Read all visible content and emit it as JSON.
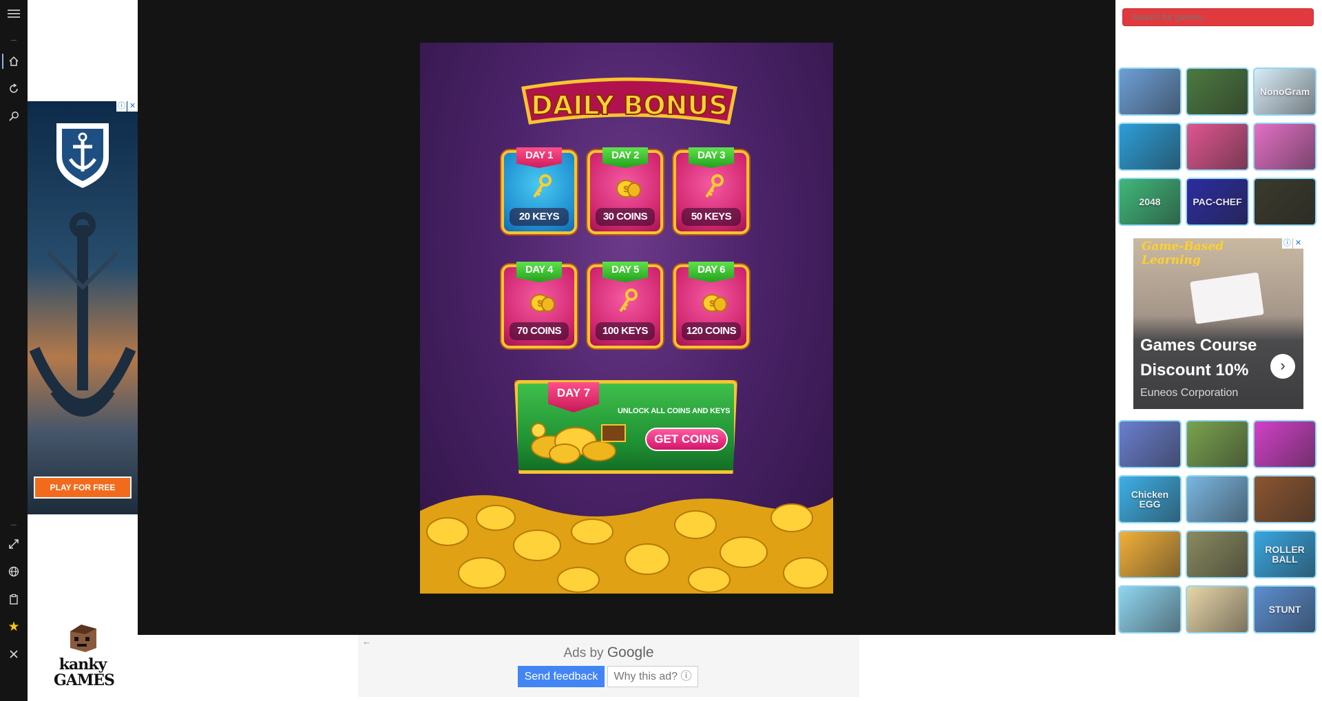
{
  "rail": {
    "icons": [
      "menu-icon",
      "home-icon",
      "refresh-icon",
      "search-icon",
      "fullscreen-icon",
      "globe-icon",
      "clipboard-icon",
      "star-icon",
      "close-icon"
    ]
  },
  "left_ad": {
    "cta": "PLAY FOR FREE",
    "adchoices_info": "ⓘ",
    "adchoices_close": "✕"
  },
  "logo": {
    "line1": "kanky",
    "line2": "GAMES"
  },
  "game": {
    "title": "DAILY BONUS",
    "days": [
      {
        "day": "DAY 1",
        "prize": "20 KEYS",
        "kind": "keys",
        "style": "blue"
      },
      {
        "day": "DAY 2",
        "prize": "30 COINS",
        "kind": "coins",
        "style": "pink"
      },
      {
        "day": "DAY 3",
        "prize": "50 KEYS",
        "kind": "keys",
        "style": "pink"
      },
      {
        "day": "DAY 4",
        "prize": "70 COINS",
        "kind": "coins",
        "style": "pink"
      },
      {
        "day": "DAY 5",
        "prize": "100 KEYS",
        "kind": "keys",
        "style": "pink"
      },
      {
        "day": "DAY 6",
        "prize": "120 COINS",
        "kind": "coins",
        "style": "pink"
      }
    ],
    "day7": {
      "label": "DAY 7",
      "text": "UNLOCK ALL COINS AND KEYS",
      "button": "GET COINS"
    }
  },
  "google_ads": {
    "back": "←",
    "ads_by": "Ads by",
    "google": "Google",
    "send_feedback": "Send feedback",
    "why": "Why this ad? ⓘ"
  },
  "search": {
    "placeholder": "Search for games.."
  },
  "thumbs_top": [
    {
      "id": "game-1",
      "label": "",
      "color": "#6d9fd6"
    },
    {
      "id": "game-2",
      "label": "",
      "color": "#4c7a3f"
    },
    {
      "id": "game-3",
      "label": "NonoGram",
      "color": "#d8ecf7"
    },
    {
      "id": "game-4",
      "label": "",
      "color": "#2c9fd8"
    },
    {
      "id": "game-5",
      "label": "",
      "color": "#e05590"
    },
    {
      "id": "game-6",
      "label": "",
      "color": "#e46fc6"
    },
    {
      "id": "game-7",
      "label": "2048",
      "color": "#3fb87a"
    },
    {
      "id": "game-8",
      "label": "PAC-CHEF",
      "color": "#2b2ca0"
    },
    {
      "id": "game-9",
      "label": "",
      "color": "#3a3a2c"
    }
  ],
  "right_ad": {
    "tagline": "Game-Based Learning",
    "headline": "Games Course Discount 10%",
    "advertiser": "Euneos Corporation",
    "arrow": "›",
    "adchoices_info": "ⓘ",
    "adchoices_close": "✕"
  },
  "thumbs_bottom": [
    {
      "id": "game-10",
      "label": "",
      "color": "#6a7fd0"
    },
    {
      "id": "game-11",
      "label": "",
      "color": "#7aa34e"
    },
    {
      "id": "game-12",
      "label": "",
      "color": "#d240c8"
    },
    {
      "id": "game-13",
      "label": "Chicken EGG",
      "color": "#3db0e6"
    },
    {
      "id": "game-14",
      "label": "",
      "color": "#7ab6e0"
    },
    {
      "id": "game-15",
      "label": "",
      "color": "#8c5530"
    },
    {
      "id": "game-16",
      "label": "",
      "color": "#f2b03a"
    },
    {
      "id": "game-17",
      "label": "",
      "color": "#8a8a60"
    },
    {
      "id": "game-18",
      "label": "ROLLER BALL",
      "color": "#38a6e0"
    },
    {
      "id": "game-19",
      "label": "",
      "color": "#8fd5f0"
    },
    {
      "id": "game-20",
      "label": "",
      "color": "#e8d6a8"
    },
    {
      "id": "game-21",
      "label": "STUNT",
      "color": "#5b8ed0"
    }
  ],
  "colors": {
    "stage_bg": "#141414",
    "search_bg": "#e03a3e",
    "thumb_border": "#8fd7f5",
    "send_feedback_bg": "#4285f4"
  }
}
